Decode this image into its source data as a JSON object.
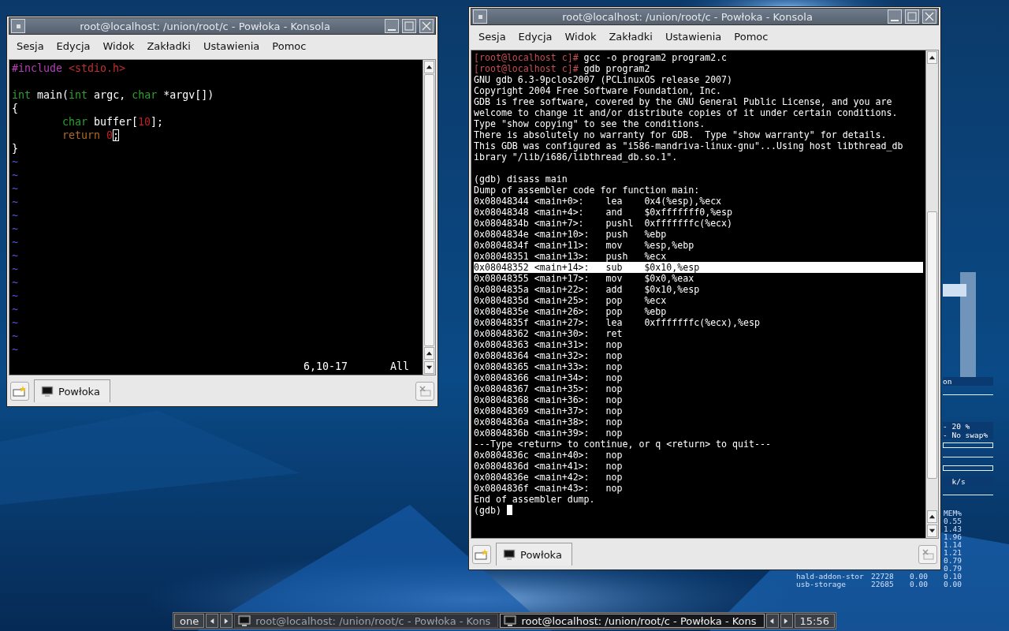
{
  "windows": [
    {
      "kind": "vim",
      "title": "root@localhost: /union/root/c - Powłoka - Konsola",
      "menu": [
        "Sesja",
        "Edycja",
        "Widok",
        "Zakładki",
        "Ustawienia",
        "Pomoc"
      ],
      "editor": {
        "lines": [
          {
            "kind": "code",
            "indented": false,
            "segments": [
              {
                "text": "#include",
                "kind": "preproc"
              },
              {
                "text": " <stdio.h>",
                "kind": "string"
              }
            ]
          },
          {
            "kind": "blank"
          },
          {
            "kind": "code",
            "indented": false,
            "segments": [
              {
                "text": "int",
                "kind": "type"
              },
              {
                "text": " main(",
                "kind": "normal"
              },
              {
                "text": "int",
                "kind": "type"
              },
              {
                "text": " argc, ",
                "kind": "normal"
              },
              {
                "text": "char",
                "kind": "type"
              },
              {
                "text": " *argv[])",
                "kind": "normal"
              }
            ]
          },
          {
            "kind": "code",
            "indented": false,
            "segments": [
              {
                "text": "{",
                "kind": "normal"
              }
            ]
          },
          {
            "kind": "code",
            "indented": true,
            "segments": [
              {
                "text": "char",
                "kind": "type"
              },
              {
                "text": " buffer[",
                "kind": "normal"
              },
              {
                "text": "10",
                "kind": "number"
              },
              {
                "text": "];",
                "kind": "normal"
              }
            ]
          },
          {
            "kind": "code",
            "indented": true,
            "segments": [
              {
                "text": "return",
                "kind": "statement"
              },
              {
                "text": " 0",
                "kind": "number"
              },
              {
                "text": ";",
                "kind": "cursor"
              }
            ]
          },
          {
            "kind": "code",
            "indented": false,
            "segments": [
              {
                "text": "}",
                "kind": "normal"
              }
            ]
          },
          {
            "kind": "tilde",
            "text": "~"
          },
          {
            "kind": "tilde",
            "text": "~"
          },
          {
            "kind": "tilde",
            "text": "~"
          },
          {
            "kind": "tilde",
            "text": "~"
          },
          {
            "kind": "tilde",
            "text": "~"
          },
          {
            "kind": "tilde",
            "text": "~"
          },
          {
            "kind": "tilde",
            "text": "~"
          },
          {
            "kind": "tilde",
            "text": "~"
          },
          {
            "kind": "tilde",
            "text": "~"
          },
          {
            "kind": "tilde",
            "text": "~"
          },
          {
            "kind": "tilde",
            "text": "~"
          },
          {
            "kind": "tilde",
            "text": "~"
          },
          {
            "kind": "tilde",
            "text": "~"
          },
          {
            "kind": "tilde",
            "text": "~"
          },
          {
            "kind": "tilde",
            "text": "~"
          }
        ],
        "status_position": "6,10-17",
        "status_scroll": "All"
      },
      "tab": "Powłoka"
    },
    {
      "kind": "gdb",
      "title": "root@localhost: /union/root/c - Powłoka - Konsola",
      "menu": [
        "Sesja",
        "Edycja",
        "Widok",
        "Zakładki",
        "Ustawienia",
        "Pomoc"
      ],
      "terminal": {
        "lines": [
          {
            "prompt": "[root@localhost c]#",
            "text": " gcc -o program2 program2.c",
            "selected": false
          },
          {
            "prompt": "[root@localhost c]#",
            "text": " gdb program2",
            "selected": false
          },
          {
            "text": "GNU gdb 6.3-9pclos2007 (PCLinuxOS release 2007)",
            "selected": false
          },
          {
            "text": "Copyright 2004 Free Software Foundation, Inc.",
            "selected": false
          },
          {
            "text": "GDB is free software, covered by the GNU General Public License, and you are",
            "selected": false
          },
          {
            "text": "welcome to change it and/or distribute copies of it under certain conditions.",
            "selected": false
          },
          {
            "text": "Type \"show copying\" to see the conditions.",
            "selected": false
          },
          {
            "text": "There is absolutely no warranty for GDB.  Type \"show warranty\" for details.",
            "selected": false
          },
          {
            "text": "This GDB was configured as \"i586-mandriva-linux-gnu\"...Using host libthread_db",
            "selected": false
          },
          {
            "text": "ibrary \"/lib/i686/libthread_db.so.1\".",
            "selected": false
          },
          {
            "selected": false
          },
          {
            "text": "(gdb) disass main",
            "selected": false
          },
          {
            "text": "Dump of assembler code for function main:",
            "selected": false
          },
          {
            "text": "0x08048344 <main+0>:    lea    0x4(%esp),%ecx",
            "selected": false
          },
          {
            "text": "0x08048348 <main+4>:    and    $0xfffffff0,%esp",
            "selected": false
          },
          {
            "text": "0x0804834b <main+7>:    pushl  0xfffffffc(%ecx)",
            "selected": false
          },
          {
            "text": "0x0804834e <main+10>:   push   %ebp",
            "selected": false
          },
          {
            "text": "0x0804834f <main+11>:   mov    %esp,%ebp",
            "selected": false
          },
          {
            "text": "0x08048351 <main+13>:   push   %ecx",
            "selected": false
          },
          {
            "text": "0x08048352 <main+14>:   sub    $0x10,%esp",
            "selected": true
          },
          {
            "text": "0x08048355 <main+17>:   mov    $0x0,%eax",
            "selected": false
          },
          {
            "text": "0x0804835a <main+22>:   add    $0x10,%esp",
            "selected": false
          },
          {
            "text": "0x0804835d <main+25>:   pop    %ecx",
            "selected": false
          },
          {
            "text": "0x0804835e <main+26>:   pop    %ebp",
            "selected": false
          },
          {
            "text": "0x0804835f <main+27>:   lea    0xfffffffc(%ecx),%esp",
            "selected": false
          },
          {
            "text": "0x08048362 <main+30>:   ret",
            "selected": false
          },
          {
            "text": "0x08048363 <main+31>:   nop",
            "selected": false
          },
          {
            "text": "0x08048364 <main+32>:   nop",
            "selected": false
          },
          {
            "text": "0x08048365 <main+33>:   nop",
            "selected": false
          },
          {
            "text": "0x08048366 <main+34>:   nop",
            "selected": false
          },
          {
            "text": "0x08048367 <main+35>:   nop",
            "selected": false
          },
          {
            "text": "0x08048368 <main+36>:   nop",
            "selected": false
          },
          {
            "text": "0x08048369 <main+37>:   nop",
            "selected": false
          },
          {
            "text": "0x0804836a <main+38>:   nop",
            "selected": false
          },
          {
            "text": "0x0804836b <main+39>:   nop",
            "selected": false
          },
          {
            "text": "---Type <return> to continue, or q <return> to quit---",
            "selected": false
          },
          {
            "text": "0x0804836c <main+40>:   nop",
            "selected": false
          },
          {
            "text": "0x0804836d <main+41>:   nop",
            "selected": false
          },
          {
            "text": "0x0804836e <main+42>:   nop",
            "selected": false
          },
          {
            "text": "0x0804836f <main+43>:   nop",
            "selected": false
          },
          {
            "text": "End of assembler dump.",
            "selected": false
          },
          {
            "text": "(gdb) ",
            "selected": false,
            "cursor": true
          }
        ]
      },
      "tab": "Powłoka"
    }
  ],
  "conky": {
    "lines": [
      {
        "kind": "text",
        "text": "on"
      },
      {
        "kind": "rule"
      },
      {
        "kind": "gap"
      },
      {
        "kind": "text",
        "text": "- 20 %"
      },
      {
        "kind": "text",
        "text": "- No swap%"
      },
      {
        "kind": "bar"
      },
      {
        "kind": "rule"
      },
      {
        "kind": "bar"
      },
      {
        "kind": "text",
        "text": "  k/s"
      },
      {
        "kind": "rule"
      }
    ],
    "mem_heading": "MEM%",
    "processes": [
      {
        "mem": "0.55"
      },
      {
        "mem": "1.43"
      },
      {
        "mem": "1.96"
      },
      {
        "mem": "1.14"
      },
      {
        "mem": "1.21"
      },
      {
        "mem": "0.79"
      },
      {
        "mem": "0.79"
      },
      {
        "name": "hald-addon-stor",
        "pid": "22728",
        "cpu": "0.00",
        "mem": "0.10"
      },
      {
        "name": "usb-storage",
        "pid": "22685",
        "cpu": "0.00",
        "mem": "0.00"
      }
    ]
  },
  "taskbar": {
    "desktop": "one",
    "tasks": [
      {
        "label": "root@localhost: /union/root/c - Powłoka - Kons",
        "selected": false
      },
      {
        "label": "root@localhost: /union/root/c - Powłoka - Kons",
        "selected": true
      }
    ],
    "clock": "15:56"
  }
}
